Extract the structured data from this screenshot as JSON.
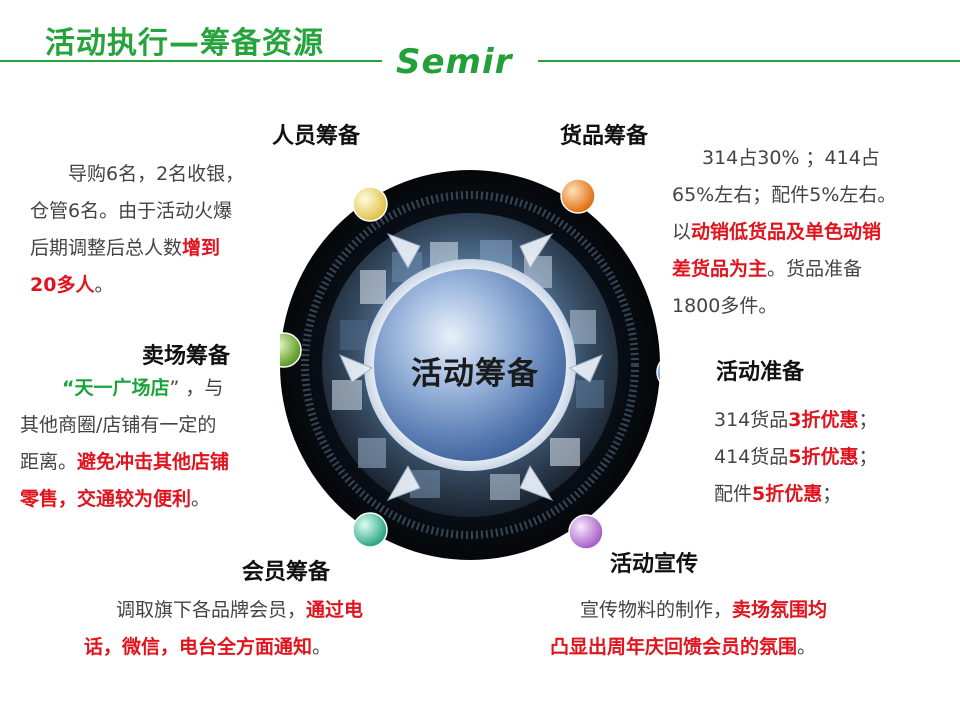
{
  "header": {
    "title": "活动执行—筹备资源",
    "logo_text": "Semir"
  },
  "center": {
    "label": "活动筹备"
  },
  "sections": {
    "staff": {
      "title": "人员筹备",
      "t1": "导购6名，2名收银，",
      "t2": "仓管6名。由于活动火爆",
      "t3": "后期调整后总人数",
      "t4": "增到",
      "t5": "20多人",
      "t6": "。"
    },
    "goods": {
      "title": "货品筹备",
      "t1": "314占30% ；414占",
      "t2": "65%左右；配件5%左右。",
      "t3": "以",
      "t4": "动销低货品及单色动销",
      "t5": "差货品为主",
      "t6": "。货品准备",
      "t7": "1800多件。"
    },
    "venue": {
      "title": "卖场筹备",
      "t1": "“",
      "t2": "天一广场店",
      "t3": "” ，与",
      "t4": "其他商圈/店铺有一定的",
      "t5": "距离。",
      "t6": "避免冲击其他店铺",
      "t7": "零售，交通较为便利",
      "t8": "。"
    },
    "prep": {
      "title": "活动准备",
      "l1a": "314货品",
      "l1b": "3折优惠",
      "l1c": "；",
      "l2a": "414货品",
      "l2b": "5折优惠",
      "l2c": "；",
      "l3a": "配件",
      "l3b": "5折优惠",
      "l3c": "；"
    },
    "member": {
      "title": "会员筹备",
      "t1": "调取旗下各品牌会员，",
      "t2": "通过电",
      "t3": "话，微信，电台全方面通知",
      "t4": "。"
    },
    "promo": {
      "title": "活动宣传",
      "t1": "宣传物料的制作，",
      "t2": "卖场氛围均",
      "t3": "凸显出周年庆回馈会员的氛围",
      "t4": "。"
    }
  },
  "colors": {
    "brand_green": "#27a33d",
    "highlight_red": "#e0141e",
    "dot_staff": "#f0d66a",
    "dot_goods": "#f08a2a",
    "dot_venue": "#7dbb3a",
    "dot_prep": "#4b8be0",
    "dot_member": "#3fbf9a",
    "dot_promo": "#c27fd6"
  },
  "icons": {
    "arrows": "arrow-icon",
    "dots": "dot-icon"
  }
}
